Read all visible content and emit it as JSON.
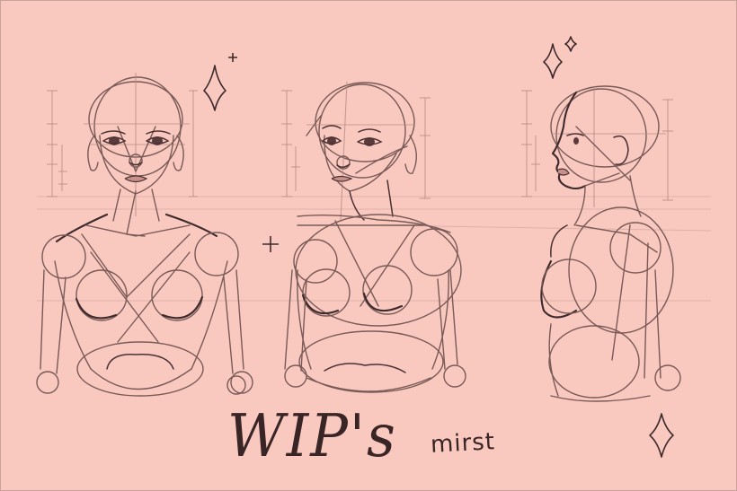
{
  "drawing": {
    "title": "WIP's",
    "signature": "mirst",
    "figures": [
      "front-view",
      "three-quarter-view",
      "side-view"
    ],
    "background_color": "#f9c9bf",
    "ink_color": "#3e2a2c",
    "sparkle_icon": "four-point-star"
  }
}
